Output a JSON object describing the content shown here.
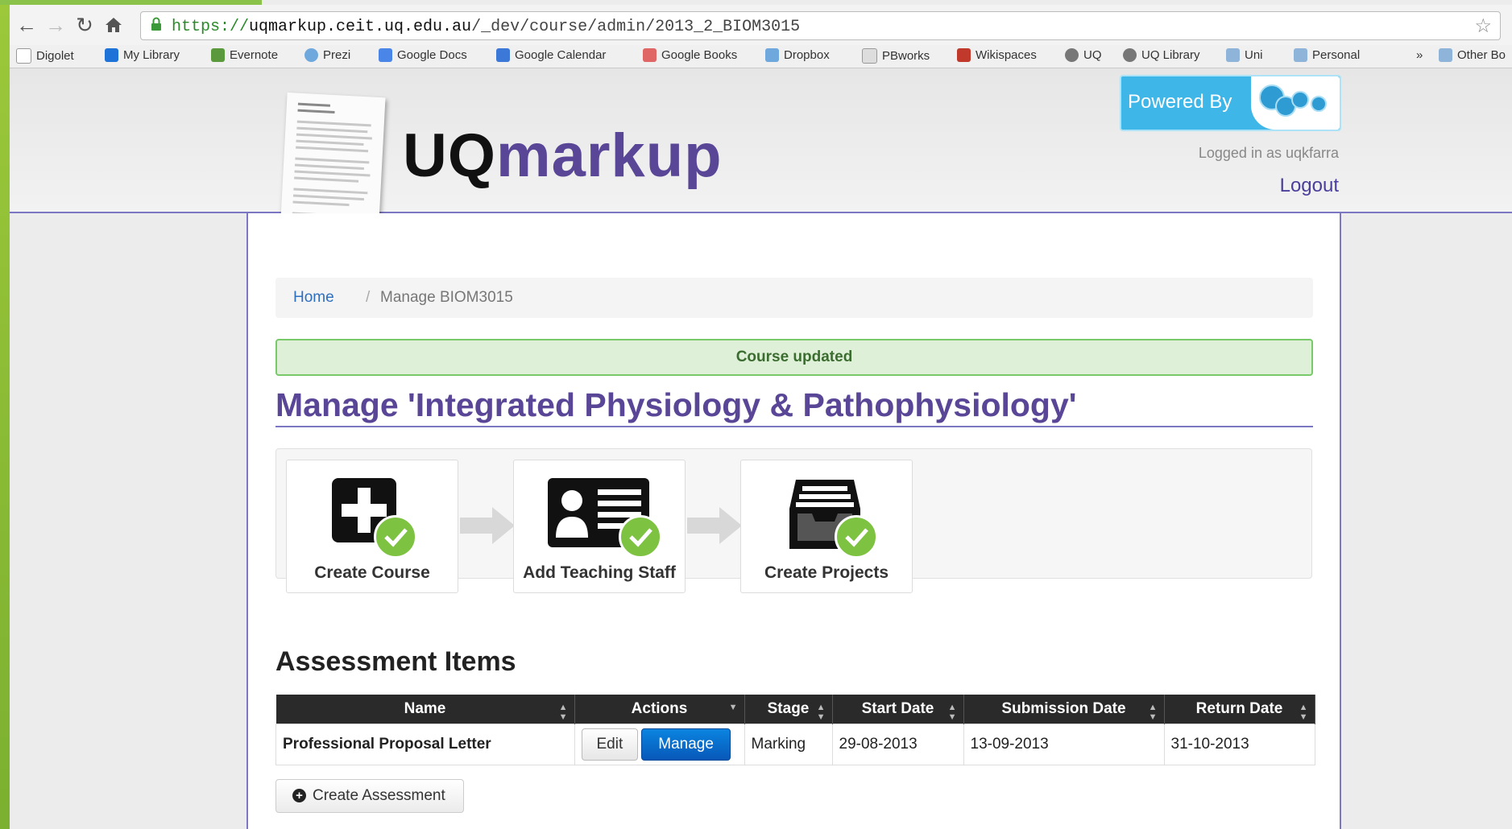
{
  "browser": {
    "url_scheme": "https://",
    "url_host": "uqmarkup.ceit.uq.edu.au",
    "url_path": "/_dev/course/admin/2013_2_BIOM3015",
    "bookmarks": [
      "Digolet",
      "My Library",
      "Evernote",
      "Prezi",
      "Google Docs",
      "Google Calendar",
      "Google Books",
      "Dropbox",
      "PBworks",
      "Wikispaces",
      "UQ",
      "UQ Library",
      "Uni",
      "Personal",
      "Other Bo"
    ],
    "overflow_label": "»"
  },
  "header": {
    "logo_uq": "UQ",
    "logo_markup": "markup",
    "powered_by": "Powered By",
    "logged_in": "Logged in as uqkfarra",
    "logout": "Logout"
  },
  "breadcrumb": {
    "home": "Home",
    "separator": "/",
    "current": "Manage BIOM3015"
  },
  "alert": "Course updated",
  "page_title": "Manage 'Integrated Physiology & Pathophysiology'",
  "steps": [
    {
      "label": "Create Course",
      "icon": "add-course-icon"
    },
    {
      "label": "Add Teaching Staff",
      "icon": "id-card-icon"
    },
    {
      "label": "Create Projects",
      "icon": "archive-box-icon"
    }
  ],
  "assessment": {
    "title": "Assessment Items",
    "columns": [
      "Name",
      "Actions",
      "Stage",
      "Start Date",
      "Submission Date",
      "Return Date"
    ],
    "rows": [
      {
        "name": "Professional Proposal Letter",
        "edit": "Edit",
        "manage": "Manage",
        "stage": "Marking",
        "start": "29-08-2013",
        "submission": "13-09-2013",
        "return": "31-10-2013"
      }
    ],
    "create_label": "Create Assessment"
  },
  "colors": {
    "brand_purple": "#5a4696",
    "success_green": "#7dc241",
    "primary_blue": "#0a6fd0"
  }
}
